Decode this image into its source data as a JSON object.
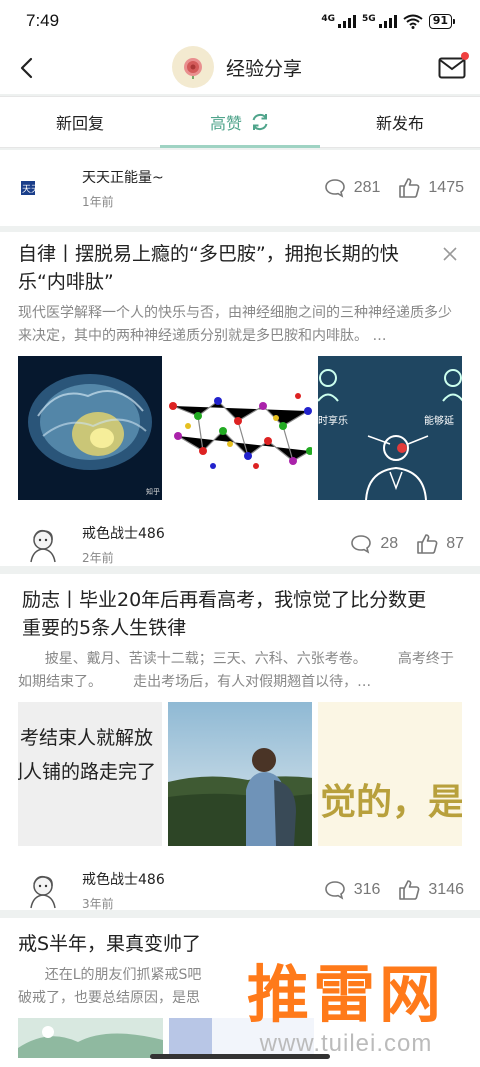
{
  "status_bar": {
    "time": "7:49",
    "net1": "4G",
    "net2": "5G",
    "battery": "91"
  },
  "nav": {
    "title": "经验分享"
  },
  "tabs": [
    {
      "label": "新回复",
      "active": false
    },
    {
      "label": "高赞",
      "active": true
    },
    {
      "label": "新发布",
      "active": false
    }
  ],
  "accent_color": "#4fa48b",
  "top_author": {
    "name": "天天正能量~",
    "time": "1年前",
    "comments": "281",
    "likes": "1475",
    "logo_text": "天天正能量"
  },
  "posts": [
    {
      "title": "自律丨摆脱易上瘾的“多巴胺”，拥抱长期的快乐“内啡肽”",
      "excerpt": "现代医学解释一个人的快乐与否，由神经细胞之间的三种神经递质多少来决定，其中的两种神经递质分别就是多巴胺和内啡肽。 …",
      "image_texts": [
        "知乎",
        "时享乐",
        "能够延"
      ],
      "author": {
        "name": "戒色战士486",
        "time": "2年前",
        "comments": "28",
        "likes": "87"
      }
    },
    {
      "title": "励志丨毕业20年后再看高考，我惊觉了比分数更重要的5条人生铁律",
      "excerpt": "      披星、戴月、苦读十二载；三天、六科、六张考卷。       高考终于如期结束了。       走出考场后，有人对假期翘首以待，…",
      "image_texts": [
        "考结束人就解放",
        "别人铺的路走完了",
        "觉的，是"
      ],
      "author": {
        "name": "戒色战士486",
        "time": "3年前",
        "comments": "316",
        "likes": "3146"
      }
    },
    {
      "title": "戒S半年，果真变帅了",
      "excerpt": "      还在L的朋友们抓紧戒S吧\n破戒了，也要总结原因，是思"
    }
  ],
  "watermark": {
    "text": "推雷网",
    "url": "www.tuilei.com"
  }
}
